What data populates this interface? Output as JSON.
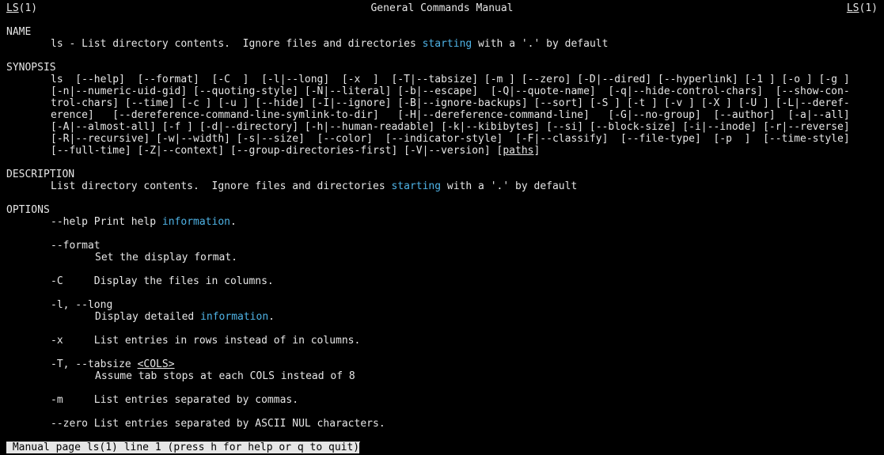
{
  "header": {
    "left_name": "LS",
    "left_section": "(1)",
    "title": "General Commands Manual",
    "right_name": "LS",
    "right_section": "(1)"
  },
  "name_section": {
    "heading": "NAME",
    "text_before": "ls - List directory contents.  Ignore files and directories ",
    "highlight": "starting",
    "text_after": " with a '.' by default"
  },
  "synopsis": {
    "heading": "SYNOPSIS",
    "lines": [
      "ls  [--help]  [--format]  [-C  ]  [-l|--long]  [-x  ]  [-T|--tabsize] [-m ] [--zero] [-D|--dired] [--hyperlink] [-1 ] [-o ] [-g ]",
      "[-n|--numeric-uid-gid] [--quoting-style] [-N|--literal] [-b|--escape]  [-Q|--quote-name]  [-q|--hide-control-chars]  [--show-con‐",
      "trol-chars] [--time] [-c ] [-u ] [--hide] [-I|--ignore] [-B|--ignore-backups] [--sort] [-S ] [-t ] [-v ] [-X ] [-U ] [-L|--deref‐",
      "erence]   [--dereference-command-line-symlink-to-dir]   [-H|--dereference-command-line]   [-G|--no-group]  [--author]  [-a|--all]",
      "[-A|--almost-all] [-f ] [-d|--directory] [-h|--human-readable] [-k|--kibibytes] [--si] [--block-size] [-i|--inode] [-r|--reverse]",
      "[-R|--recursive] [-w|--width] [-s|--size]  [--color]  [--indicator-style]  [-F|--classify]  [--file-type]  [-p  ]  [--time-style]"
    ],
    "last_line_before": "[--full-time] [-Z|--context] [--group-directories-first] [-V|--version] [",
    "last_line_link": "paths",
    "last_line_after": "]"
  },
  "description": {
    "heading": "DESCRIPTION",
    "text_before": "List directory contents.  Ignore files and directories ",
    "highlight": "starting",
    "text_after": " with a '.' by default"
  },
  "options": {
    "heading": "OPTIONS",
    "help_before": "--help Print help ",
    "help_highlight": "information",
    "help_after": ".",
    "format_flag": "--format",
    "format_desc": "Set the display format.",
    "c_line": "-C     Display the files in columns.",
    "l_flag": "-l, --long",
    "l_desc_before": "Display detailed ",
    "l_desc_highlight": "information",
    "l_desc_after": ".",
    "x_line": "-x     List entries in rows instead of in columns.",
    "t_flag": "-T, --tabsize ",
    "t_arg": "<COLS>",
    "t_desc": "Assume tab stops at each COLS instead of 8",
    "m_line": "-m     List entries separated by commas.",
    "zero_line": "--zero List entries separated by ASCII NUL characters."
  },
  "status_bar": {
    "text": " Manual page ls(1) line 1 (press h for help or q to quit)"
  },
  "colors": {
    "background": "#000000",
    "foreground": "#e6e6e6",
    "highlight": "#4fb3e6",
    "status_bg": "#e6e6e6"
  }
}
